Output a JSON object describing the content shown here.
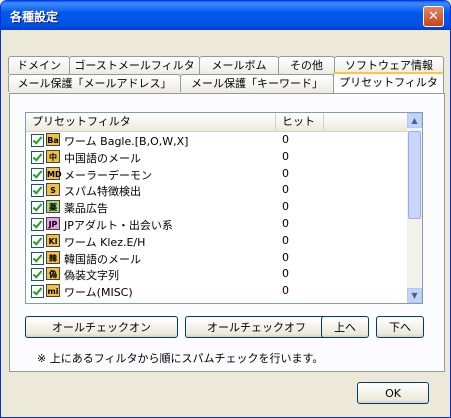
{
  "window": {
    "title": "各種設定",
    "close_label": "✕"
  },
  "tabs_row1": [
    "ドメイン",
    "ゴーストメールフィルタ",
    "メールボム",
    "その他",
    "ソフトウェア情報"
  ],
  "tabs_row2": [
    "メール保護「メールアドレス」",
    "メール保護「キーワード」",
    "プリセットフィルタ"
  ],
  "active_tab": "プリセットフィルタ",
  "list": {
    "columns": [
      "プリセットフィルタ",
      "ヒット"
    ],
    "rows": [
      {
        "name": "ワーム Bagle.[B,O,W,X]",
        "hit": "0",
        "icon": "Ba",
        "icon_color": "#f0c040",
        "checked": true
      },
      {
        "name": "中国語のメール",
        "hit": "0",
        "icon": "中",
        "icon_color": "#f0c040",
        "checked": true
      },
      {
        "name": "メーラーデーモン",
        "hit": "0",
        "icon": "MD",
        "icon_color": "#f0c040",
        "checked": true
      },
      {
        "name": "スパム特徴検出",
        "hit": "0",
        "icon": "S",
        "icon_color": "#f0c040",
        "checked": true
      },
      {
        "name": "薬品広告",
        "hit": "0",
        "icon": "薬",
        "icon_color": "#a8d870",
        "checked": true
      },
      {
        "name": "JPアダルト・出会い系",
        "hit": "0",
        "icon": "JP",
        "icon_color": "#e8a0e8",
        "checked": true
      },
      {
        "name": "ワーム Klez.E/H",
        "hit": "0",
        "icon": "Kl",
        "icon_color": "#f0c040",
        "checked": true
      },
      {
        "name": "韓国語のメール",
        "hit": "0",
        "icon": "韓",
        "icon_color": "#f0c040",
        "checked": true
      },
      {
        "name": "偽装文字列",
        "hit": "0",
        "icon": "偽",
        "icon_color": "#f0c040",
        "checked": true
      },
      {
        "name": "ワーム(MISC)",
        "hit": "0",
        "icon": "mi",
        "icon_color": "#f0c040",
        "checked": true
      }
    ]
  },
  "buttons": {
    "all_check_on": "オールチェックオン",
    "all_check_off": "オールチェックオフ",
    "up": "上へ",
    "down": "下へ",
    "ok": "OK"
  },
  "note": "※ 上にあるフィルタから順にスパムチェックを行います。"
}
